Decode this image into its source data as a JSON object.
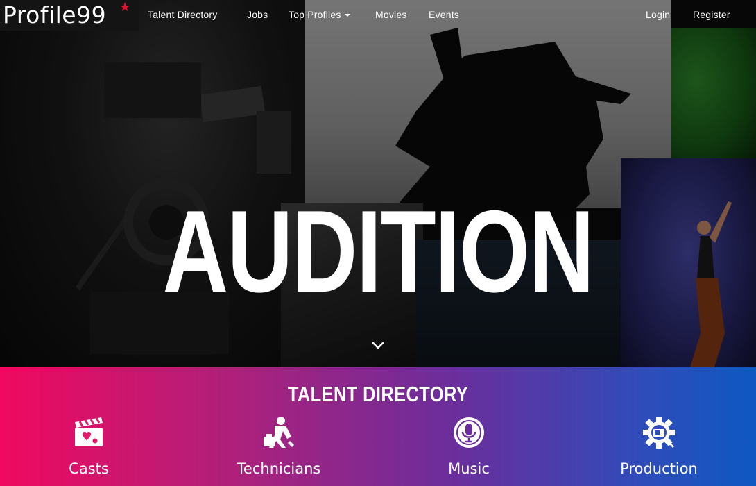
{
  "brand": {
    "name": "Profile99",
    "star_color": "#e8102e"
  },
  "nav": {
    "items": [
      {
        "label": "Talent Directory"
      },
      {
        "label": "Jobs"
      },
      {
        "label": "Top Profiles"
      },
      {
        "label": "Movies"
      },
      {
        "label": "Events"
      }
    ],
    "login": "Login",
    "register": "Register"
  },
  "hero": {
    "title": "AUDITION",
    "scroll_icon": "chevron-down-icon"
  },
  "talent": {
    "title": "TALENT DIRECTORY",
    "gradient": [
      "#f0095f",
      "#6a2e9c",
      "#0e58c2"
    ],
    "categories": [
      {
        "label": "Casts",
        "icon": "clapperboard-icon"
      },
      {
        "label": "Technicians",
        "icon": "technician-icon"
      },
      {
        "label": "Music",
        "icon": "microphone-icon"
      },
      {
        "label": "Production",
        "icon": "production-gear-icon"
      }
    ]
  }
}
